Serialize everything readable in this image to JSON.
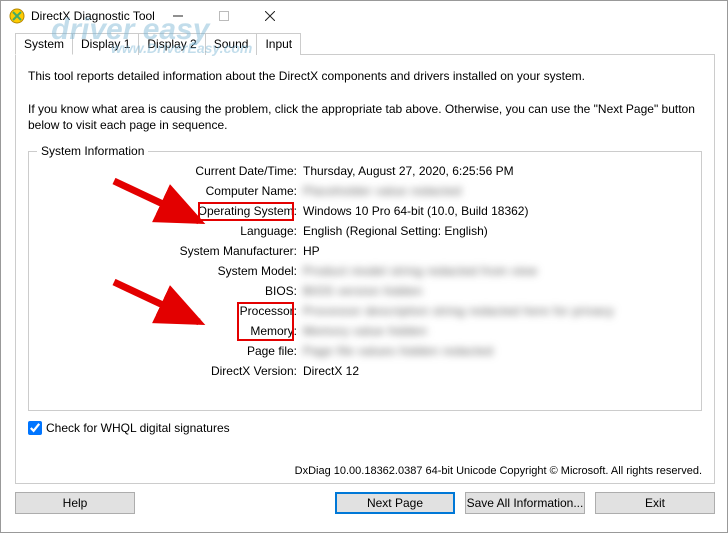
{
  "window": {
    "title": "DirectX Diagnostic Tool"
  },
  "tabs": [
    "System",
    "Display 1",
    "Display 2",
    "Sound",
    "Input"
  ],
  "intro": {
    "line1": "This tool reports detailed information about the DirectX components and drivers installed on your system.",
    "line2": "If you know what area is causing the problem, click the appropriate tab above.  Otherwise, you can use the \"Next Page\" button below to visit each page in sequence."
  },
  "fieldset_label": "System Information",
  "rows": [
    {
      "key": "Current Date/Time:",
      "val": "Thursday, August 27, 2020, 6:25:56 PM",
      "blur": false
    },
    {
      "key": "Computer Name:",
      "val": "Placeholder value redacted",
      "blur": true
    },
    {
      "key": "Operating System:",
      "val": "Windows 10 Pro 64-bit (10.0, Build 18362)",
      "blur": false
    },
    {
      "key": "Language:",
      "val": "English (Regional Setting: English)",
      "blur": false
    },
    {
      "key": "System Manufacturer:",
      "val": "HP",
      "blur": false
    },
    {
      "key": "System Model:",
      "val": "Product model string redacted from view",
      "blur": true
    },
    {
      "key": "BIOS:",
      "val": "BIOS version hidden",
      "blur": true
    },
    {
      "key": "Processor:",
      "val": "Processor description string redacted here for privacy",
      "blur": true
    },
    {
      "key": "Memory:",
      "val": "Memory value hidden",
      "blur": true
    },
    {
      "key": "Page file:",
      "val": "Page file values hidden redacted",
      "blur": true
    },
    {
      "key": "DirectX Version:",
      "val": "DirectX 12",
      "blur": false
    }
  ],
  "whql_label": "Check for WHQL digital signatures",
  "copyright": "DxDiag 10.00.18362.0387 64-bit Unicode  Copyright © Microsoft. All rights reserved.",
  "buttons": {
    "help": "Help",
    "next": "Next Page",
    "save": "Save All Information...",
    "exit": "Exit"
  },
  "watermark": {
    "line1": "driver easy",
    "line2": "www.DriverEasy.com"
  }
}
